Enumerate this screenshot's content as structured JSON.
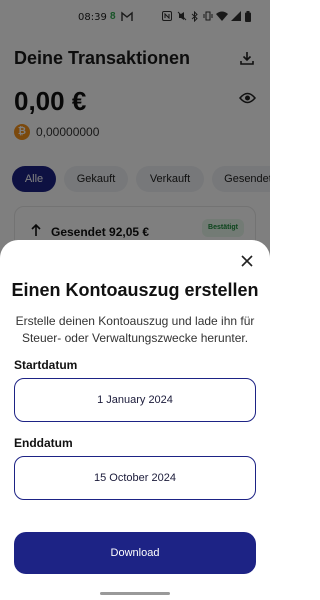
{
  "status_bar": {
    "time": "08:39",
    "icons": [
      "green-app-icon",
      "gmail-icon",
      "nfc-icon",
      "mute-icon",
      "bluetooth-icon",
      "vibrate-icon",
      "wifi-icon",
      "signal-icon",
      "battery-icon"
    ]
  },
  "page": {
    "title": "Deine Transaktionen",
    "balance": "0,00 €",
    "btc_amount": "0,00000000",
    "filters": [
      "Alle",
      "Gekauft",
      "Verkauft",
      "Gesendet"
    ],
    "active_filter": "Alle",
    "transaction": {
      "label": "Gesendet 92,05 €",
      "status": "Bestätigt"
    }
  },
  "sheet": {
    "title": "Einen Kontoauszug erstellen",
    "description": "Erstelle deinen Kontoauszug und lade ihn für Steuer- oder Verwaltungszwecke herunter.",
    "start_label": "Startdatum",
    "start_value": "1 January 2024",
    "end_label": "Enddatum",
    "end_value": "15 October 2024",
    "download_label": "Download"
  },
  "colors": {
    "accent": "#1d2385",
    "bitcoin": "#f7931a",
    "success": "#1a8a3a"
  }
}
